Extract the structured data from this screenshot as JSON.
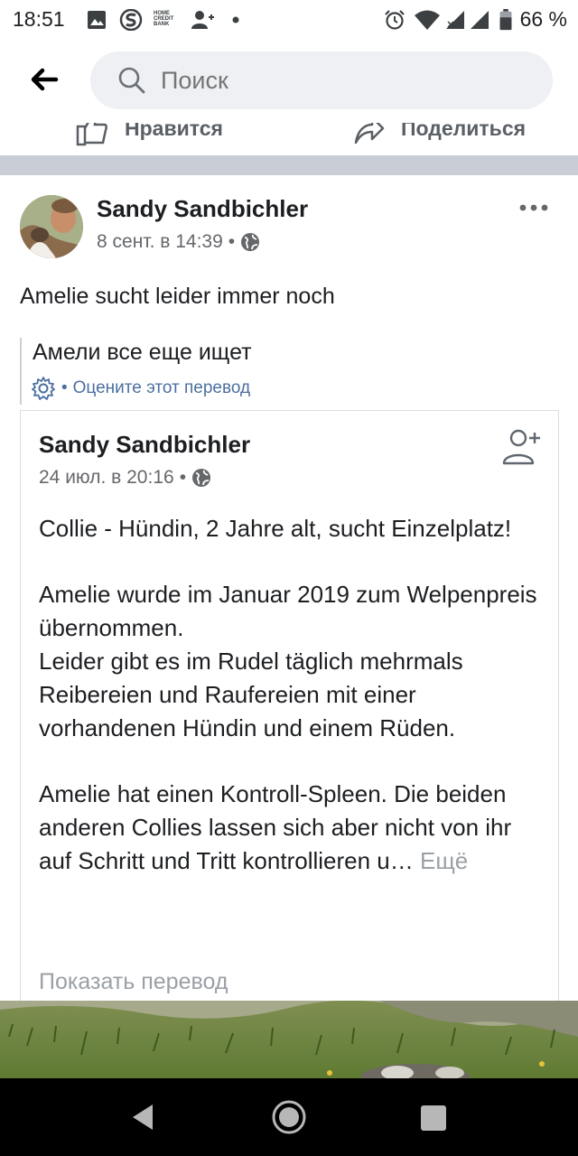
{
  "status_bar": {
    "time": "18:51",
    "battery_percent": "66 %",
    "home_credit_line1": "HOME",
    "home_credit_line2": "CREDIT",
    "home_credit_line3": "BANK",
    "icons": [
      "gallery-icon",
      "s-app-icon",
      "home-credit-icon",
      "person-add-icon",
      "dot-icon",
      "alarm-icon",
      "wifi-icon",
      "signal-icon",
      "signal-icon",
      "battery-icon"
    ]
  },
  "header": {
    "search_placeholder": "Поиск"
  },
  "prev_actions": {
    "like_label": "Нравится",
    "share_label": "Поделиться"
  },
  "post": {
    "author": "Sandy Sandbichler",
    "date": "8 сент. в 14:39",
    "dot": "•",
    "text": "Amelie sucht leider immer noch",
    "translation": {
      "text": "Амели все еще ищет",
      "dot": "•",
      "rate_label": "Оцените этот перевод"
    },
    "shared": {
      "author": "Sandy Sandbichler",
      "date": "24 июл. в 20:16",
      "dot": "•",
      "paragraph1": "Collie - Hündin, 2 Jahre alt, sucht Einzelplatz!",
      "paragraph2": "Amelie wurde im Januar 2019 zum Welpenpreis übernommen.",
      "paragraph3": "Leider gibt es im Rudel täglich mehrmals Reibereien und Raufereien mit einer vorhandenen Hündin und einem Rüden.",
      "paragraph4": "Amelie hat einen Kontroll-Spleen. Die beiden anderen Collies lassen sich aber nicht von ihr auf Schritt und Tritt kontrollieren u…",
      "more_label": "Ещё",
      "show_translation": "Показать перевод"
    }
  },
  "colors": {
    "link_blue": "#4b6fa0",
    "separator": "#c9ced6",
    "muted": "#9aa0a6"
  }
}
